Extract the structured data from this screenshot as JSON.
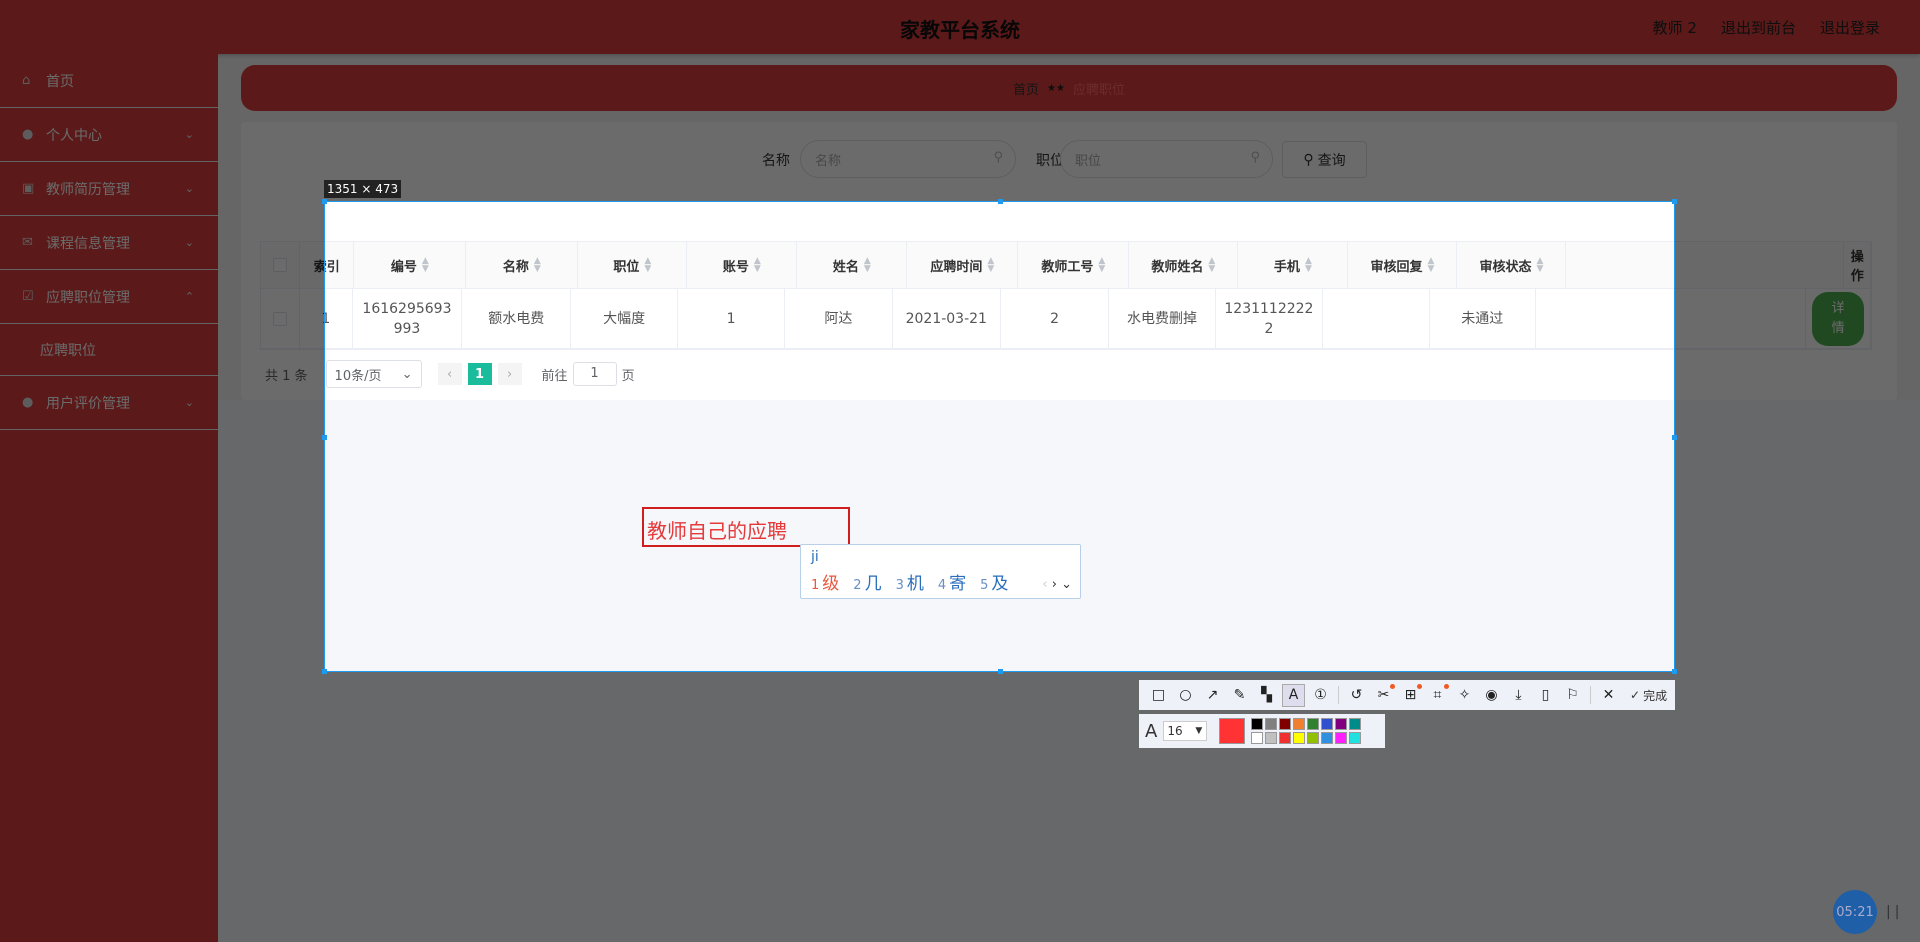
{
  "header": {
    "title": "家教平台系统",
    "user": "教师 2",
    "front": "退出到前台",
    "logout": "退出登录"
  },
  "sidebar": {
    "items": [
      {
        "label": "首页",
        "icon": "home-icon"
      },
      {
        "label": "个人中心",
        "icon": "user-icon"
      },
      {
        "label": "教师简历管理",
        "icon": "briefcase-icon"
      },
      {
        "label": "课程信息管理",
        "icon": "mail-icon"
      },
      {
        "label": "应聘职位管理",
        "icon": "edit-icon"
      }
    ],
    "sub": "应聘职位",
    "last": {
      "label": "用户评价管理",
      "icon": "user-icon"
    }
  },
  "breadcrumb": {
    "home": "首页",
    "sep": "★★",
    "current": "应聘职位"
  },
  "search": {
    "name_label": "名称",
    "name_placeholder": "名称",
    "pos_label": "职位",
    "pos_placeholder": "职位",
    "query": "查询"
  },
  "table": {
    "columns": [
      "索引",
      "编号",
      "名称",
      "职位",
      "账号",
      "姓名",
      "应聘时间",
      "教师工号",
      "教师姓名",
      "手机",
      "审核回复",
      "审核状态",
      "",
      "操作"
    ],
    "rows": [
      [
        "1",
        "1616295693993",
        "额水电费",
        "大幅度",
        "1",
        "阿达",
        "2021-03-21",
        "2",
        "水电费删掉",
        "12311122222",
        "",
        "未通过",
        "",
        "详情"
      ]
    ]
  },
  "pagination": {
    "total": "共 1 条",
    "page_size": "10条/页",
    "current": "1",
    "goto": "前往",
    "goto_value": "1",
    "page_unit": "页"
  },
  "capture": {
    "size": "1351 × 473",
    "text": "教师自己的应聘",
    "toolbar_done": "完成",
    "font_size": "16",
    "current_color": "#ff3333",
    "palette": [
      "#000000",
      "#808080",
      "#800000",
      "#f08030",
      "#308030",
      "#3050d0",
      "#800080",
      "#008b8b",
      "#ffffff",
      "#c0c0c0",
      "#f03030",
      "#ffff00",
      "#90c000",
      "#3090e0",
      "#ff20ff",
      "#20e0e0"
    ]
  },
  "ime": {
    "pinyin": "ji",
    "candidates": [
      "级",
      "几",
      "机",
      "寄",
      "及"
    ]
  },
  "timer": "05:21",
  "colors": {
    "accent": "#d83c3c",
    "detail": "#4caf50",
    "page_active": "#1abc9c"
  }
}
